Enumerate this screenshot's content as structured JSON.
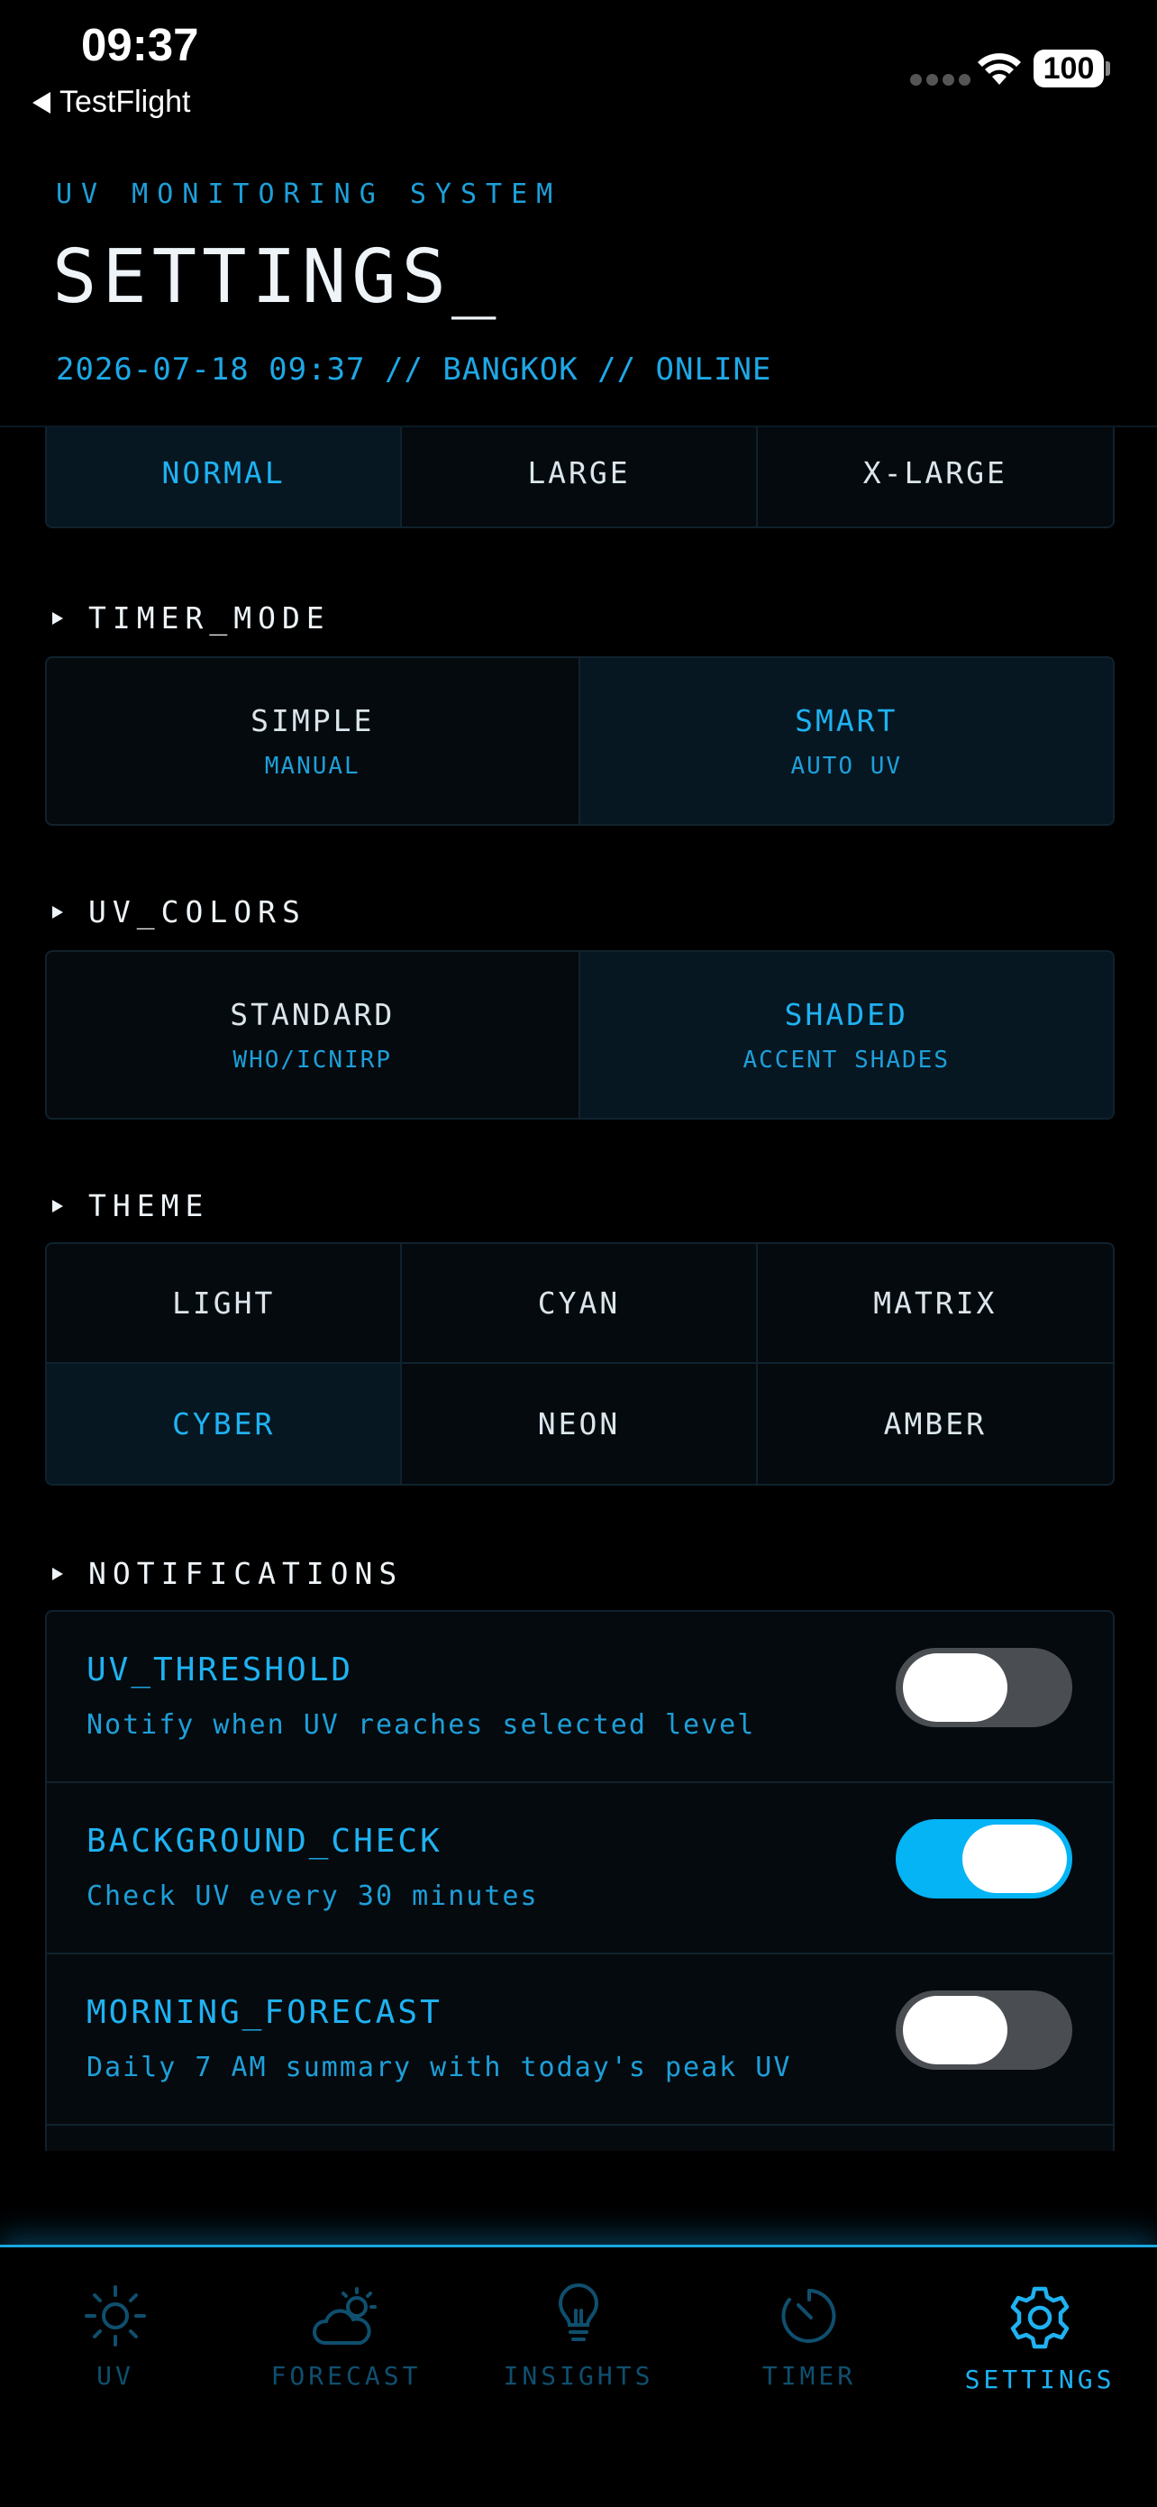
{
  "status_bar": {
    "time": "09:37",
    "back_label": "TestFlight",
    "battery": "100"
  },
  "header": {
    "kicker": "UV MONITORING SYSTEM",
    "title": "SETTINGS_",
    "meta": "2026-07-18 09:37 // BANGKOK // ONLINE"
  },
  "text_size": {
    "options": [
      "NORMAL",
      "LARGE",
      "X-LARGE"
    ],
    "selected": "NORMAL"
  },
  "timer_mode": {
    "heading": "TIMER_MODE",
    "options": [
      {
        "label": "SIMPLE",
        "sub": "MANUAL"
      },
      {
        "label": "SMART",
        "sub": "AUTO UV"
      }
    ],
    "selected": "SMART"
  },
  "uv_colors": {
    "heading": "UV_COLORS",
    "options": [
      {
        "label": "STANDARD",
        "sub": "WHO/ICNIRP"
      },
      {
        "label": "SHADED",
        "sub": "ACCENT SHADES"
      }
    ],
    "selected": "SHADED"
  },
  "theme": {
    "heading": "THEME",
    "options": [
      "LIGHT",
      "CYAN",
      "MATRIX",
      "CYBER",
      "NEON",
      "AMBER"
    ],
    "selected": "CYBER"
  },
  "notifications": {
    "heading": "NOTIFICATIONS",
    "items": [
      {
        "title": "UV_THRESHOLD",
        "desc": "Notify when UV reaches selected level",
        "enabled": false
      },
      {
        "title": "BACKGROUND_CHECK",
        "desc": "Check UV every 30 minutes",
        "enabled": true
      },
      {
        "title": "MORNING_FORECAST",
        "desc": "Daily 7 AM summary with today's peak UV",
        "enabled": false
      }
    ]
  },
  "tabs": [
    {
      "label": "UV",
      "icon": "sun-icon"
    },
    {
      "label": "FORECAST",
      "icon": "cloud-sun-icon"
    },
    {
      "label": "INSIGHTS",
      "icon": "lightbulb-icon"
    },
    {
      "label": "TIMER",
      "icon": "timer-icon"
    },
    {
      "label": "SETTINGS",
      "icon": "gear-icon"
    }
  ],
  "active_tab": "SETTINGS",
  "colors": {
    "accent": "#1fb2f2",
    "background": "#000000",
    "toggle_on": "#04b4f4",
    "toggle_off": "#4a4e52"
  }
}
